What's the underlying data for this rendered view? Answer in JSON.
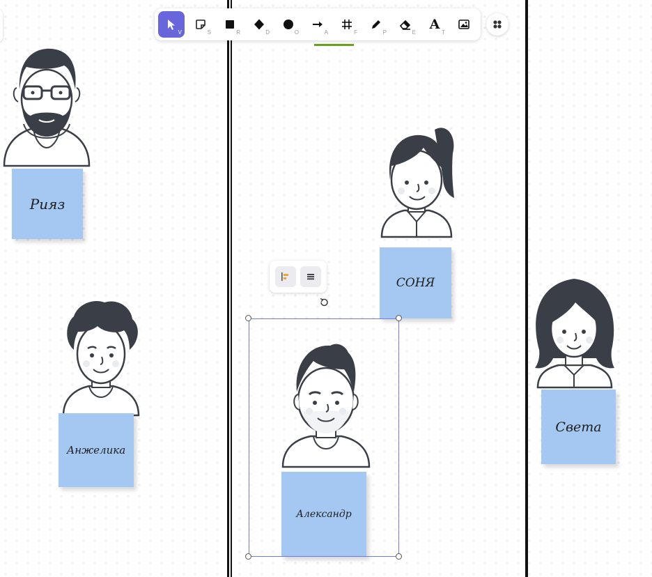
{
  "toolbar": {
    "tools": [
      {
        "name": "selection",
        "icon": "pointer-icon",
        "key": "V",
        "active": true
      },
      {
        "name": "sticky-note",
        "icon": "sticky-note-icon",
        "key": "S"
      },
      {
        "name": "rectangle",
        "icon": "square-icon",
        "key": "R"
      },
      {
        "name": "diamond",
        "icon": "diamond-icon",
        "key": "D"
      },
      {
        "name": "ellipse",
        "icon": "circle-icon",
        "key": "O"
      },
      {
        "name": "arrow",
        "icon": "arrow-icon",
        "key": "A"
      },
      {
        "name": "frame",
        "icon": "hash-icon",
        "key": "F"
      },
      {
        "name": "pencil",
        "icon": "pencil-icon",
        "key": "P"
      },
      {
        "name": "eraser",
        "icon": "eraser-icon",
        "key": "E"
      },
      {
        "name": "text",
        "icon": "text-icon",
        "key": "T",
        "glyph": "A"
      },
      {
        "name": "image",
        "icon": "image-icon",
        "key": ""
      }
    ],
    "apps_icon": "apps-icon"
  },
  "notes": {
    "riyaz": "Рияз",
    "angelika": "Анжелика",
    "sonya": "СОНЯ",
    "alexander": "Александр",
    "sveta": "Света"
  },
  "context_toolbar": {
    "icons": [
      "align-left-icon",
      "menu-icon"
    ]
  },
  "colors": {
    "accent": "#6965db",
    "sticky": "#a5c8f2",
    "selection": "#6d79ec",
    "ink": "#3a3f47",
    "green": "#6aa121"
  }
}
